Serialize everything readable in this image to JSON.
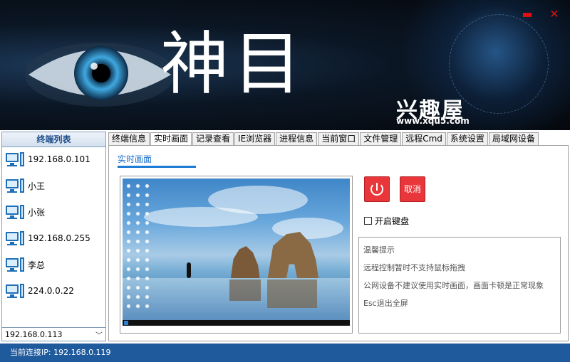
{
  "window": {
    "title": "神目",
    "brand": "兴趣屋",
    "brand_url": "www.xqu5.com",
    "minimize_label": "▬",
    "close_label": "✕"
  },
  "sidebar": {
    "title": "终端列表",
    "items": [
      {
        "label": "192.168.0.101"
      },
      {
        "label": "小王"
      },
      {
        "label": "小张"
      },
      {
        "label": "192.168.0.255"
      },
      {
        "label": "李总"
      },
      {
        "label": "224.0.0.22"
      }
    ],
    "selected_ip": "192.168.0.113"
  },
  "tabs": [
    {
      "label": "终端信息"
    },
    {
      "label": "实时画面"
    },
    {
      "label": "记录查看"
    },
    {
      "label": "IE浏览器"
    },
    {
      "label": "进程信息"
    },
    {
      "label": "当前窗口"
    },
    {
      "label": "文件管理"
    },
    {
      "label": "远程Cmd"
    },
    {
      "label": "系统设置"
    },
    {
      "label": "局域网设备"
    }
  ],
  "active_tab": "实时画面",
  "realtime": {
    "subtab_label": "实时画面",
    "cancel_label": "取消",
    "keyboard_label": "开启键盘",
    "keyboard_checked": false,
    "tips": [
      "温馨提示",
      "远程控制暂时不支持鼠标拖拽",
      "公网设备不建议使用实时画面，画面卡顿是正常现象",
      "Esc退出全屏"
    ]
  },
  "status_bar": {
    "text": "当前连接IP: 192.168.0.119"
  },
  "colors": {
    "accent": "#1c6fc7",
    "status_bar": "#1f5a9c",
    "button_red": "#e8363a"
  }
}
